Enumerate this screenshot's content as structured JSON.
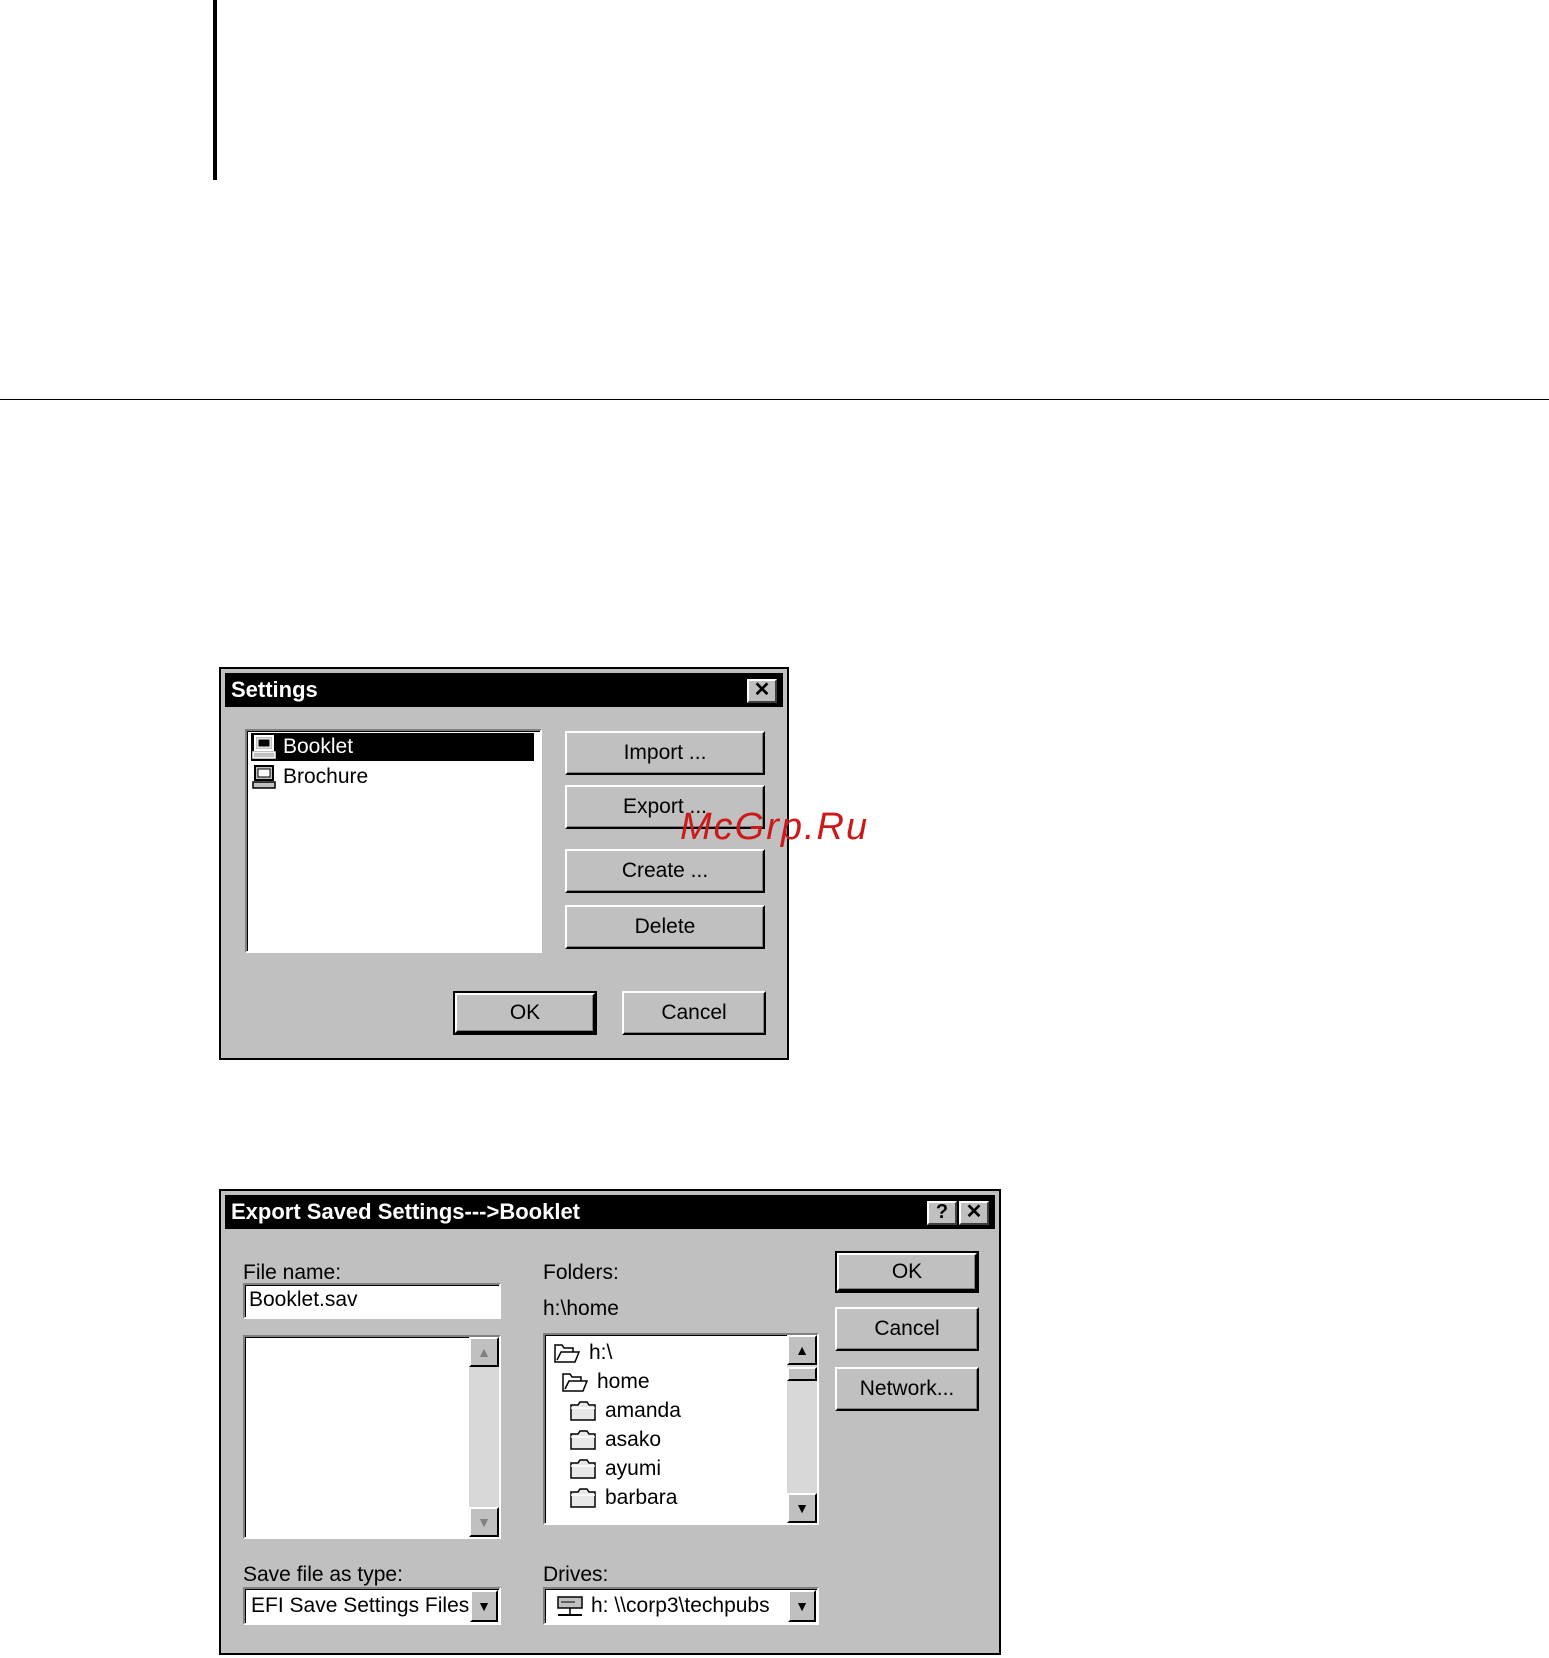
{
  "settings_dialog": {
    "title": "Settings",
    "items": [
      {
        "label": "Booklet",
        "selected": true
      },
      {
        "label": "Brochure",
        "selected": false
      }
    ],
    "import_label": "Import ...",
    "export_label": "Export ...",
    "create_label": "Create ...",
    "delete_label": "Delete",
    "ok_label": "OK",
    "cancel_label": "Cancel",
    "close_glyph": "✕"
  },
  "export_dialog": {
    "title": "Export Saved Settings--->Booklet",
    "help_glyph": "?",
    "close_glyph": "✕",
    "file_name_label": "File name:",
    "file_name_value": "Booklet.sav",
    "folders_label": "Folders:",
    "current_folder": "h:\\home",
    "folders": [
      {
        "label": "h:\\",
        "type": "open"
      },
      {
        "label": "home",
        "type": "open"
      },
      {
        "label": "amanda",
        "type": "closed"
      },
      {
        "label": "asako",
        "type": "closed"
      },
      {
        "label": "ayumi",
        "type": "closed"
      },
      {
        "label": "barbara",
        "type": "closed"
      }
    ],
    "ok_label": "OK",
    "cancel_label": "Cancel",
    "network_label": "Network...",
    "save_type_label": "Save file as type:",
    "save_type_value": "EFI Save Settings Files",
    "drives_label": "Drives:",
    "drives_value": "h: \\\\corp3\\techpubs"
  },
  "watermark": "McGrp.Ru"
}
